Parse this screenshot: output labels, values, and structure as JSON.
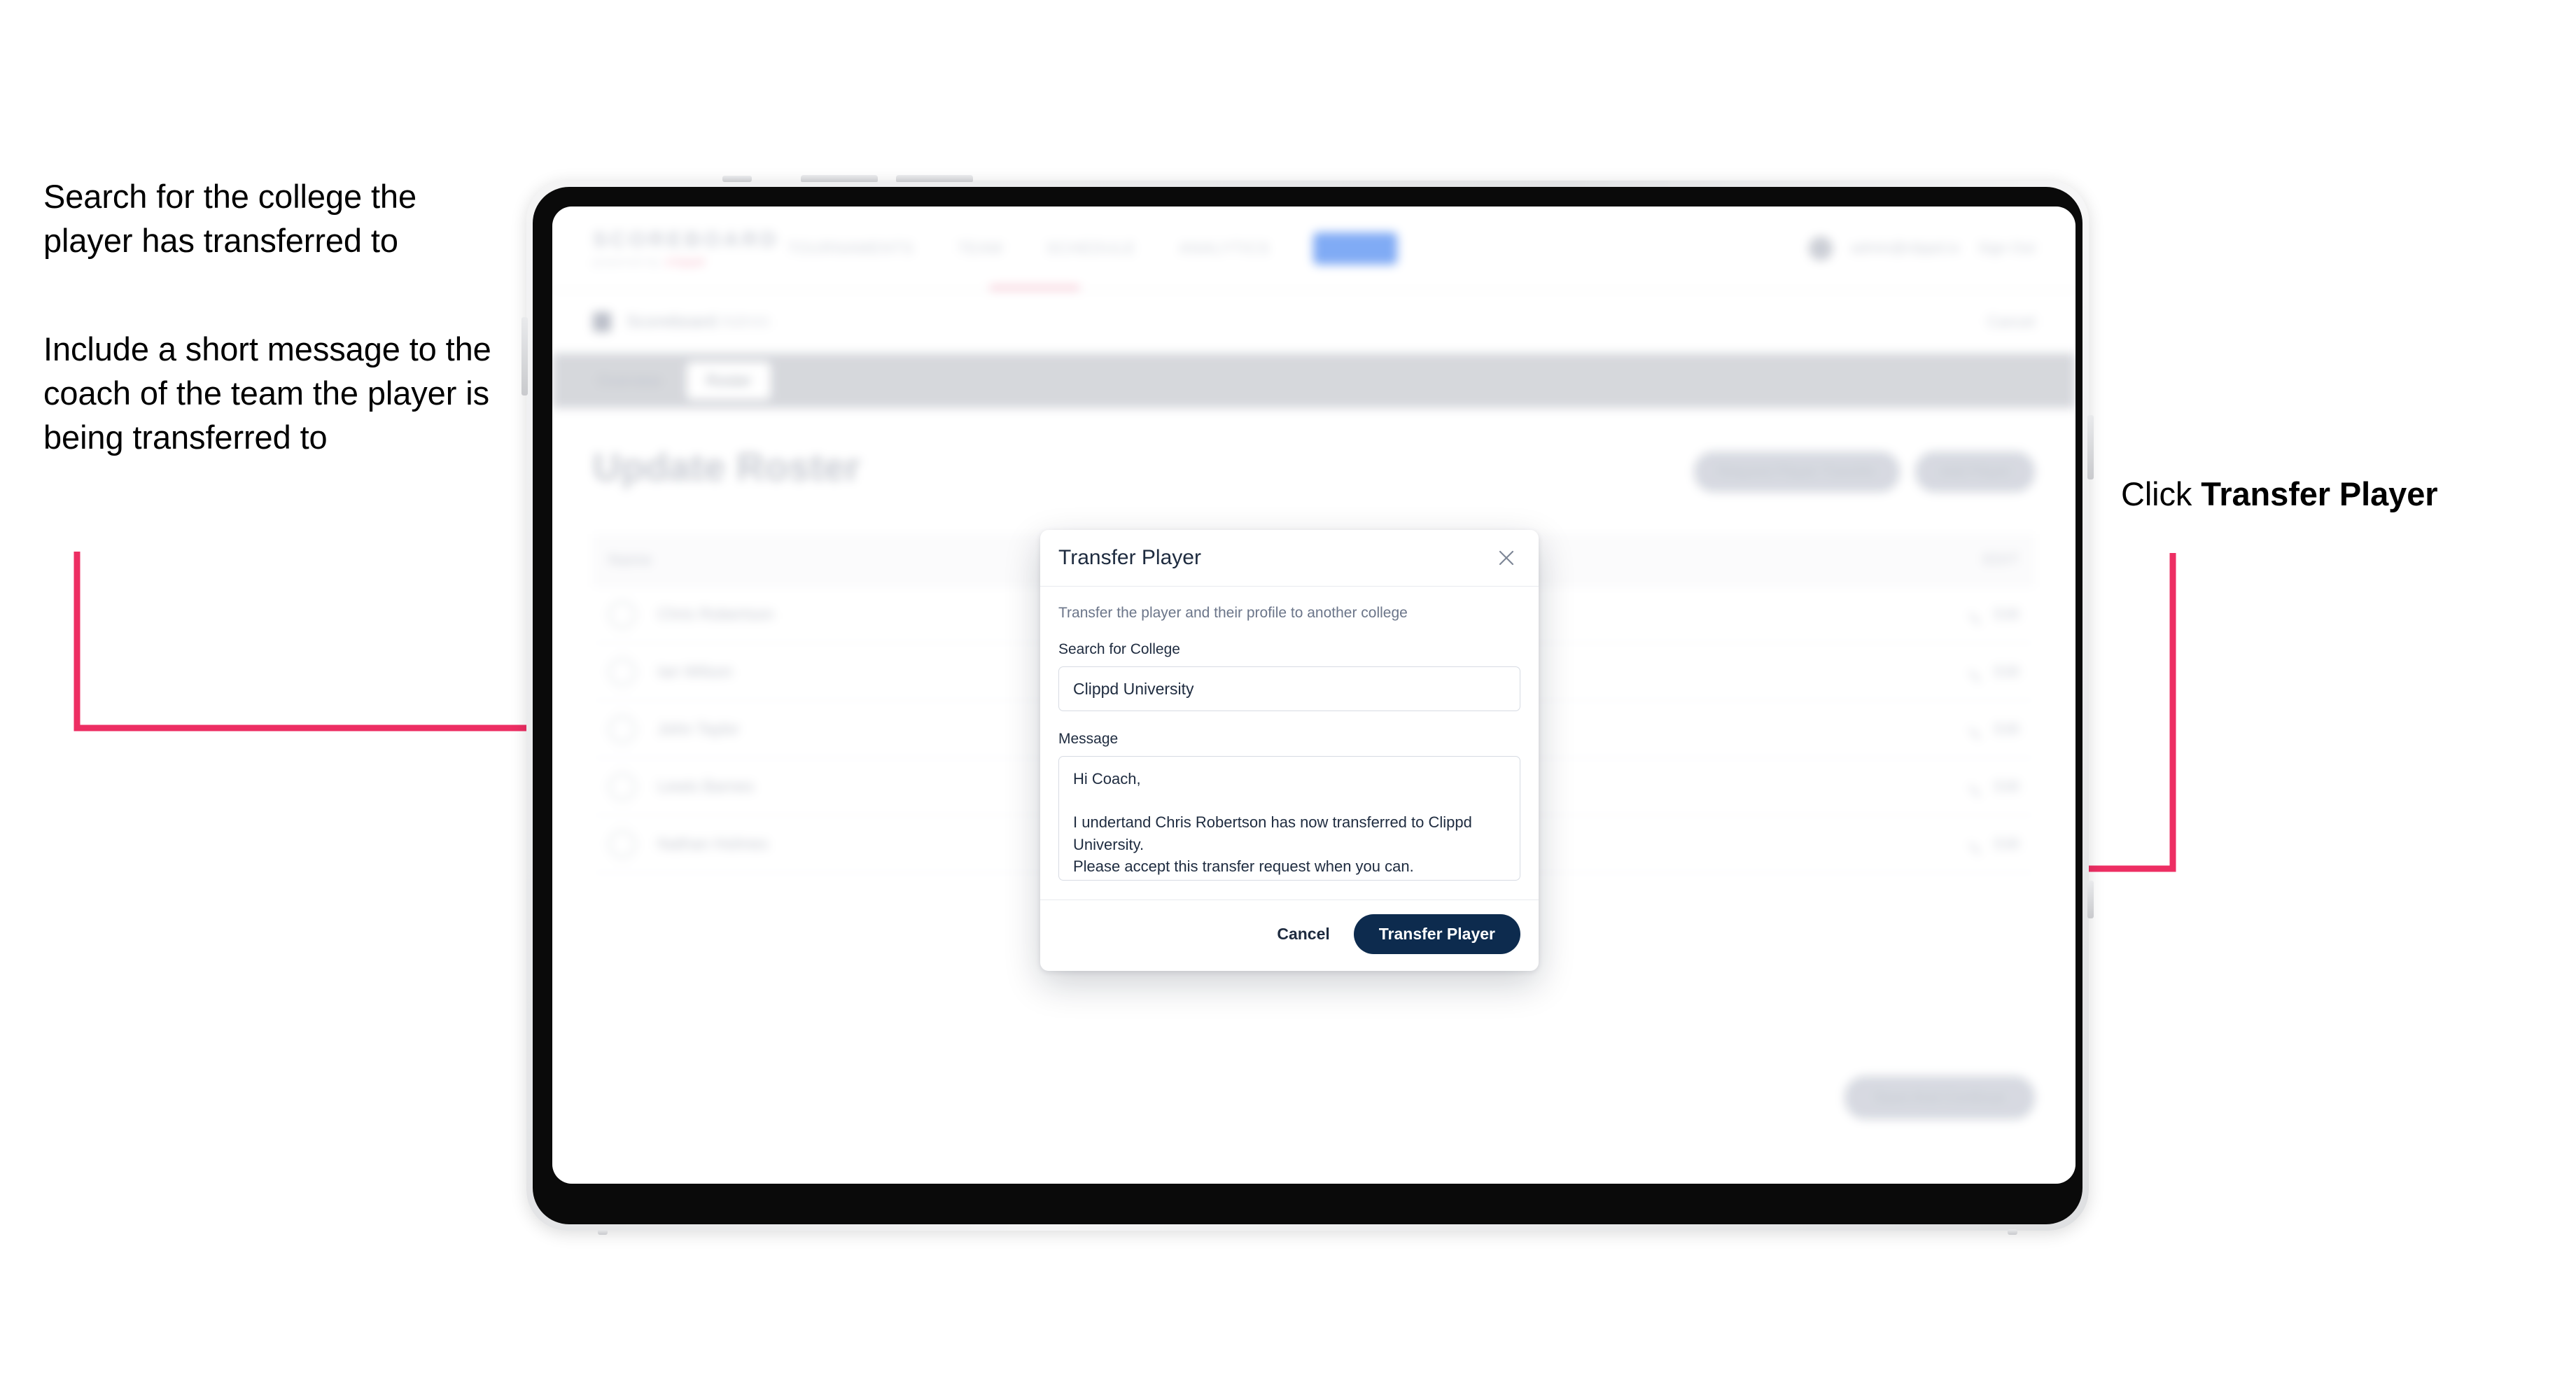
{
  "annotations": {
    "left_note_1": "Search for the college the player has transferred to",
    "left_note_2": "Include a short message to the coach of the team the player is being transferred to",
    "right_note_prefix": "Click ",
    "right_note_emphasis": "Transfer Player",
    "arrow_color": "#ED2E63"
  },
  "device": {
    "type": "tablet",
    "frame_color": "#e3e4e6",
    "bezel_color": "#0a0a0a"
  },
  "app": {
    "topnav": {
      "brand_name": "SCOREBOARD",
      "brand_sub": "powered by",
      "brand_sub_accent": "clippd",
      "links": [
        {
          "label": "TOURNAMENTS",
          "active": false
        },
        {
          "label": "TEAM",
          "active": false
        },
        {
          "label": "SCHEDULE",
          "active": false
        },
        {
          "label": "ANALYTICS",
          "active": false
        }
      ],
      "pill_label": "ADMIN",
      "user_email": "admin@clippd.io",
      "signout_label": "Sign Out"
    },
    "breadcrumb": {
      "icon": "shield-icon",
      "text": "Scoreboard",
      "text_muted": "Admin",
      "cancel_label": "Cancel"
    },
    "tabs": [
      {
        "label": "Overview",
        "active": false
      },
      {
        "label": "Roster",
        "active": true
      }
    ],
    "page": {
      "title": "Update Roster",
      "actions": [
        {
          "label": "Request Player Transfer",
          "icon": "transfer-icon"
        },
        {
          "label": "Add Player",
          "icon": "plus-icon"
        }
      ],
      "table": {
        "column_name": "Name",
        "column_edit": "EDIT",
        "rows": [
          {
            "name": "Chris Robertson",
            "action": "Edit"
          },
          {
            "name": "Ian Wilson",
            "action": "Edit"
          },
          {
            "name": "John Taylor",
            "action": "Edit"
          },
          {
            "name": "Lewis Barnes",
            "action": "Edit"
          },
          {
            "name": "Nathan Holmes",
            "action": "Edit"
          }
        ]
      },
      "footer_action": "Save And Continue"
    }
  },
  "modal": {
    "title": "Transfer Player",
    "close_icon": "close-icon",
    "subtitle": "Transfer the player and their profile to another college",
    "search_label": "Search for College",
    "search_value": "Clippd University",
    "search_placeholder": "Search for College",
    "message_label": "Message",
    "message_value": "Hi Coach,\n\nI undertand Chris Robertson has now transferred to Clippd University.\nPlease accept this transfer request when you can.",
    "message_placeholder": "Message",
    "cancel_label": "Cancel",
    "submit_label": "Transfer Player",
    "submit_color": "#0D2B4E"
  }
}
